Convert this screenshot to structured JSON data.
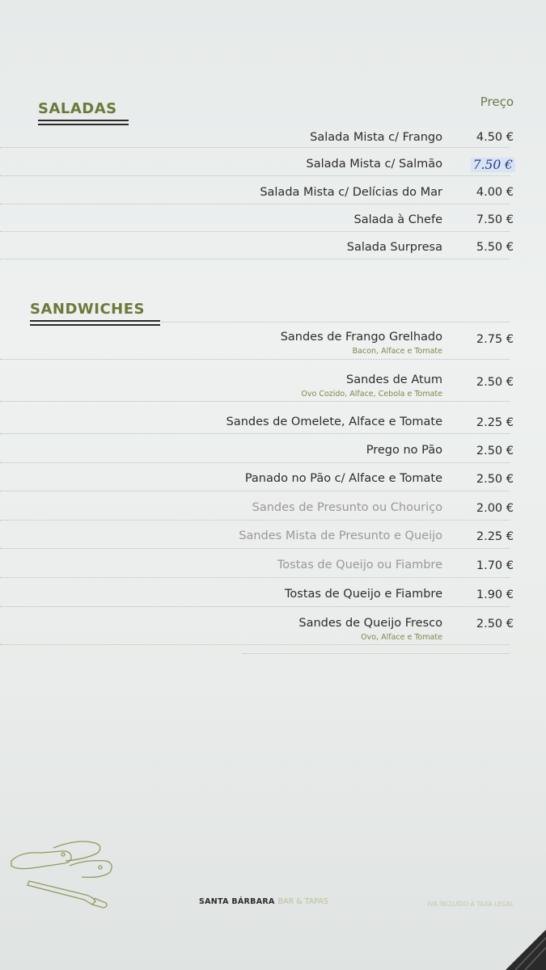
{
  "price_header": "Preço",
  "saladas": {
    "title": "SALADAS",
    "items": [
      {
        "name": "Salada Mista c/ Frango",
        "price": "4.50 €"
      },
      {
        "name": "Salada Mista c/ Salmão",
        "price": "7.50 €"
      },
      {
        "name": "Salada Mista c/ Delícias do Mar",
        "price": "4.00 €"
      },
      {
        "name": "Salada à Chefe",
        "price": "7.50 €"
      },
      {
        "name": "Salada Surpresa",
        "price": "5.50 €"
      }
    ]
  },
  "sandwiches": {
    "title": "SANDWICHES",
    "items": [
      {
        "name": "Sandes de Frango Grelhado",
        "desc": "Bacon, Alface e Tomate",
        "price": "2.75 €"
      },
      {
        "name": "Sandes de Atum",
        "desc": "Ovo Cozido, Alface, Cebola e Tomate",
        "price": "2.50 €"
      },
      {
        "name": "Sandes de Omelete, Alface e Tomate",
        "price": "2.25 €"
      },
      {
        "name": "Prego no Pão",
        "price": "2.50 €"
      },
      {
        "name": "Panado no Pão c/ Alface e Tomate",
        "price": "2.50 €"
      },
      {
        "name": "Sandes de Presunto ou Chouriço",
        "price": "2.00 €"
      },
      {
        "name": "Sandes Mista de Presunto e Queijo",
        "price": "2.25 €"
      },
      {
        "name": "Tostas de Queijo ou Fiambre",
        "price": "1.70 €"
      },
      {
        "name": "Tostas de Queijo e Fiambre",
        "price": "1.90 €"
      },
      {
        "name": "Sandes de Queijo Fresco",
        "desc": "Ovo, Alface e Tomate",
        "price": "2.50 €"
      }
    ]
  },
  "footer": {
    "brand": "SANTA BÁRBARA",
    "tagline": "BAR & TAPAS",
    "note": "IVA INCLUÍDO À TAXA LEGAL"
  },
  "colors": {
    "accent": "#6b7a3a",
    "text": "#2e2a2b",
    "handwritten": "#2a3a8a"
  }
}
